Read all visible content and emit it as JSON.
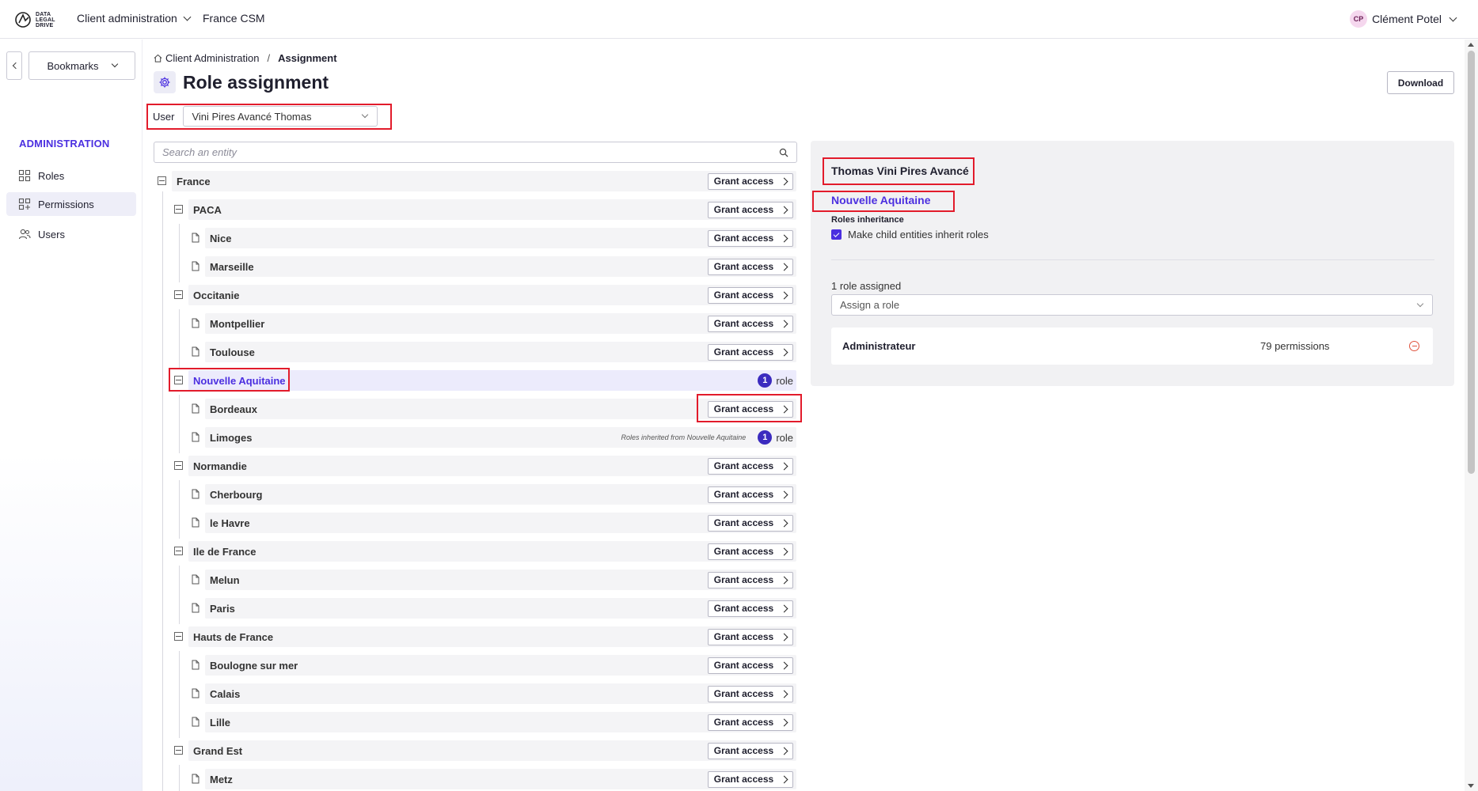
{
  "header": {
    "logo_text": [
      "DATA",
      "LEGAL",
      "DRIVE"
    ],
    "menu_client_admin": "Client administration",
    "menu_france_csm": "France CSM",
    "user_initials": "CP",
    "user_name": "Clément Potel"
  },
  "sidebar": {
    "bookmarks_label": "Bookmarks",
    "section_title": "ADMINISTRATION",
    "items": [
      {
        "label": "Roles",
        "icon": "grid-icon"
      },
      {
        "label": "Permissions",
        "icon": "grid-plus-icon"
      },
      {
        "label": "Users",
        "icon": "users-icon"
      }
    ]
  },
  "breadcrumb": {
    "root": "Client Administration",
    "separator": "/",
    "current": "Assignment"
  },
  "page": {
    "title": "Role assignment",
    "download_label": "Download",
    "user_label": "User",
    "user_value": "Vini Pires Avancé Thomas",
    "search_placeholder": "Search an entity"
  },
  "tree": {
    "grant_label": "Grant access",
    "role_word": "role",
    "inherit_note": "Roles inherited from Nouvelle Aquitaine",
    "rows": [
      {
        "name": "France"
      },
      {
        "name": "PACA"
      },
      {
        "name": "Nice"
      },
      {
        "name": "Marseille"
      },
      {
        "name": "Occitanie"
      },
      {
        "name": "Montpellier"
      },
      {
        "name": "Toulouse"
      },
      {
        "name": "Nouvelle Aquitaine",
        "roles": "1"
      },
      {
        "name": "Bordeaux"
      },
      {
        "name": "Limoges",
        "roles": "1"
      },
      {
        "name": "Normandie"
      },
      {
        "name": "Cherbourg"
      },
      {
        "name": "le Havre"
      },
      {
        "name": "Ile de France"
      },
      {
        "name": "Melun"
      },
      {
        "name": "Paris"
      },
      {
        "name": "Hauts de France"
      },
      {
        "name": "Boulogne sur mer"
      },
      {
        "name": "Calais"
      },
      {
        "name": "Lille"
      },
      {
        "name": "Grand Est"
      },
      {
        "name": "Metz"
      }
    ]
  },
  "panel": {
    "user_full_name": "Thomas Vini Pires Avancé",
    "entity_name": "Nouvelle Aquitaine",
    "inheritance_title": "Roles inheritance",
    "inheritance_checkbox_label": "Make child entities inherit roles",
    "inheritance_checked": true,
    "role_count_text": "1 role assigned",
    "assign_placeholder": "Assign a role",
    "roles": [
      {
        "name": "Administrateur",
        "permissions": "79 permissions"
      }
    ]
  },
  "colors": {
    "accent": "#4b2fe0",
    "badge": "#3b2bbf",
    "highlight": "#e21b2b",
    "remove": "#e0533d"
  }
}
